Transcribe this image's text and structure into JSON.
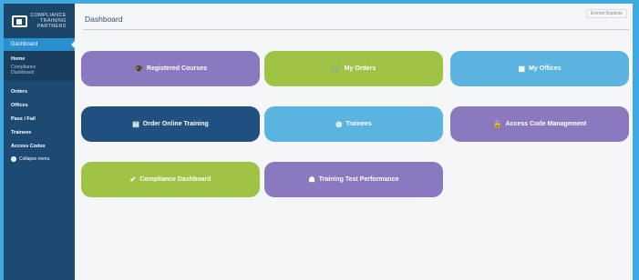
{
  "logo": {
    "line1": "COMPLIANCE",
    "line2": "TRAINING",
    "line3": "PARTNERS"
  },
  "sidebar": {
    "active": "Dashboard",
    "group": {
      "home": "Home",
      "sub1": "Compliance",
      "sub2": "Dashboard"
    },
    "items": [
      {
        "label": "Orders"
      },
      {
        "label": "Offices"
      },
      {
        "label": "Pass / Fail"
      },
      {
        "label": "Trainees"
      },
      {
        "label": "Access Codes"
      }
    ],
    "collapse": "Collapse menu"
  },
  "header": {
    "title": "Dashboard",
    "user_menu": "Emmet Baptiste"
  },
  "tiles": [
    {
      "label": "Registered Courses",
      "icon": "graduation-cap-icon",
      "color": "#8b79c0"
    },
    {
      "label": "My Orders",
      "icon": "cart-icon",
      "color": "#9fc345"
    },
    {
      "label": "My Offices",
      "icon": "building-icon",
      "color": "#5bb3df"
    },
    {
      "label": "Order Online Training",
      "icon": "document-icon",
      "color": "#20507f"
    },
    {
      "label": "Trainees",
      "icon": "globe-icon",
      "color": "#5bb3df"
    },
    {
      "label": "Access Code Management",
      "icon": "lock-icon",
      "color": "#8b79c0"
    },
    {
      "label": "Compliance Dashboard",
      "icon": "check-circle-icon",
      "color": "#9fc345"
    },
    {
      "label": "Training Test Performance",
      "icon": "person-icon",
      "color": "#8b79c0"
    }
  ]
}
